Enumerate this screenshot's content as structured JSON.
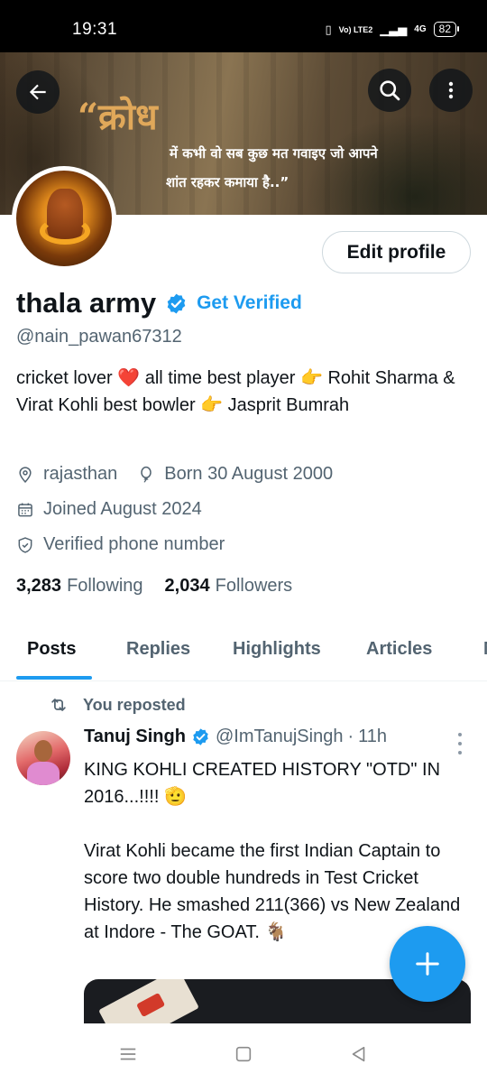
{
  "status_bar": {
    "time": "19:31",
    "vibrate_icon": "vibrate-icon",
    "volte_label": "Vo) LTE2",
    "signal_icon": "signal-bars-icon",
    "network_label": "4G",
    "battery": "82"
  },
  "banner": {
    "title": "“क्रोध",
    "line1": "में कभी वो सब कुछ मत गवाइए जो आपने",
    "line2": "शांत रहकर कमाया है..”"
  },
  "header_actions": {
    "back_icon": "arrow-left-icon",
    "search_icon": "search-icon",
    "more_icon": "more-vertical-icon"
  },
  "profile": {
    "edit_label": "Edit profile",
    "display_name": "thala army",
    "get_verified_label": "Get Verified",
    "handle": "@nain_pawan67312",
    "bio": "cricket lover ❤️ all time best player 👉 Rohit Sharma & Virat Kohli  best bowler 👉 Jasprit Bumrah",
    "location": "rajasthan",
    "birthday": "Born 30 August 2000",
    "joined": "Joined August 2024",
    "verified_phone": "Verified phone number",
    "following_count": "3,283",
    "following_label": "Following",
    "followers_count": "2,034",
    "followers_label": "Followers"
  },
  "tabs": [
    {
      "label": "Posts",
      "active": true
    },
    {
      "label": "Replies",
      "active": false
    },
    {
      "label": "Highlights",
      "active": false
    },
    {
      "label": "Articles",
      "active": false
    },
    {
      "label": "M",
      "active": false
    }
  ],
  "post": {
    "repost_label": "You reposted",
    "author": "Tanuj Singh",
    "handle": "@ImTanujSingh",
    "separator": "·",
    "time": "11h",
    "text": "KING KOHLI CREATED HISTORY \"OTD\" IN 2016...!!!! 🫡\n\nVirat Kohli became the first Indian Captain to score two double hundreds in Test Cricket History. He smashed 211(366) vs New Zealand at Indore - The GOAT. 🐐"
  },
  "fab": {
    "icon": "plus-icon"
  },
  "colors": {
    "accent": "#1d9bf0",
    "text_primary": "#0f1419",
    "text_secondary": "#536471",
    "banner_title": "#e0a85a"
  }
}
